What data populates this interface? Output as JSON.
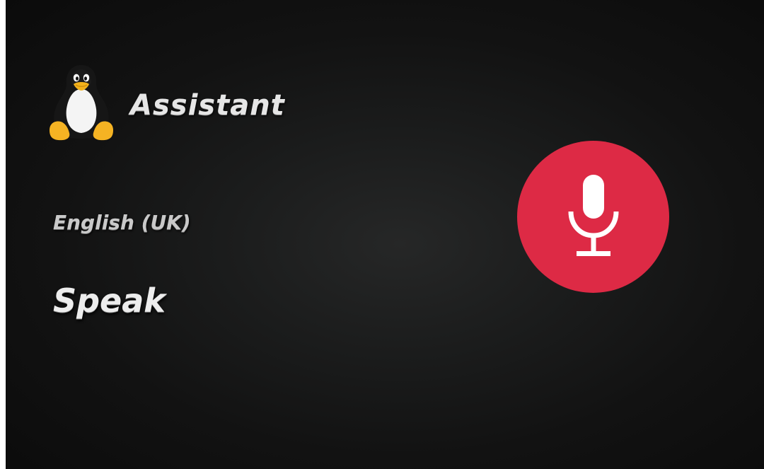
{
  "header": {
    "logo_icon": "penguin-icon",
    "title": "Assistant"
  },
  "language": {
    "label": "English (UK)"
  },
  "status": {
    "text": "Speak"
  },
  "mic": {
    "icon": "microphone-icon",
    "button_color": "#dd2a45",
    "icon_color": "#ffffff"
  }
}
